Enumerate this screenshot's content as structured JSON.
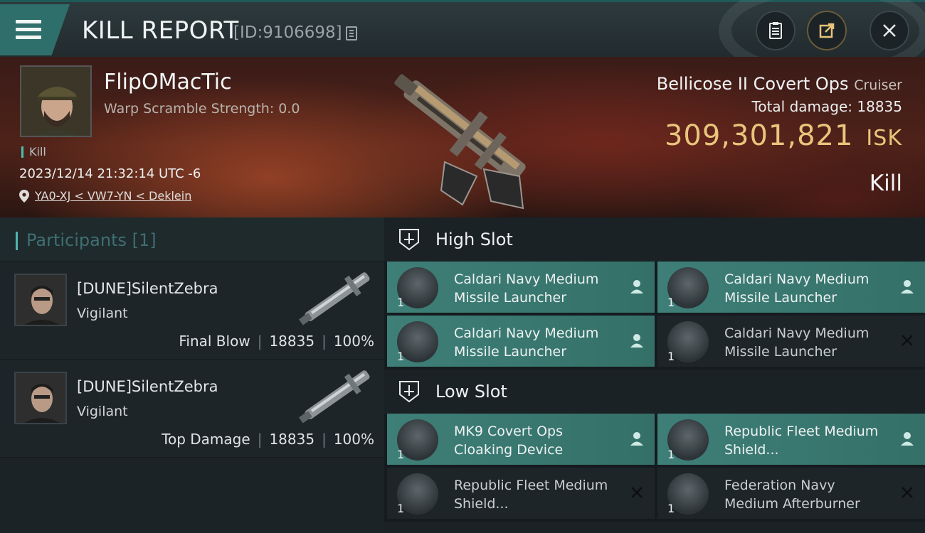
{
  "window": {
    "title": "KILL REPORT",
    "report_id": "[ID:9106698]"
  },
  "victim": {
    "name": "FlipOMacTic",
    "warp_scramble": "Warp Scramble Strength: 0.0",
    "tag": "Kill",
    "timestamp": "2023/12/14 21:32:14 UTC -6",
    "location": "YA0-XJ < VW7-YN < Deklein",
    "ship_name": "Bellicose II Covert Ops",
    "ship_class": "Cruiser",
    "total_damage_label": "Total damage:",
    "total_damage": "18835",
    "isk_value": "309,301,821",
    "isk_unit": "ISK",
    "result": "Kill"
  },
  "participants": {
    "header": "Participants [1]",
    "items": [
      {
        "name": "[DUNE]SilentZebra",
        "ship": "Vigilant",
        "role": "Final Blow",
        "damage": "18835",
        "percent": "100%"
      },
      {
        "name": "[DUNE]SilentZebra",
        "ship": "Vigilant",
        "role": "Top Damage",
        "damage": "18835",
        "percent": "100%"
      }
    ]
  },
  "fitting": {
    "high_slot_label": "High Slot",
    "low_slot_label": "Low Slot",
    "high_slot": [
      {
        "name": "Caldari Navy Medium Missile Launcher",
        "qty": "1",
        "status": "dropped"
      },
      {
        "name": "Caldari Navy Medium Missile Launcher",
        "qty": "1",
        "status": "dropped"
      },
      {
        "name": "Caldari Navy Medium Missile Launcher",
        "qty": "1",
        "status": "dropped"
      },
      {
        "name": "Caldari Navy Medium Missile Launcher",
        "qty": "1",
        "status": "destroyed"
      }
    ],
    "low_slot": [
      {
        "name": "MK9 Covert Ops Cloaking Device",
        "qty": "1",
        "status": "dropped"
      },
      {
        "name": "Republic Fleet Medium Shield...",
        "qty": "1",
        "status": "dropped"
      },
      {
        "name": "Republic Fleet Medium Shield...",
        "qty": "1",
        "status": "destroyed"
      },
      {
        "name": "Federation Navy Medium Afterburner",
        "qty": "1",
        "status": "destroyed"
      }
    ]
  },
  "colors": {
    "accent_teal": "#3e7f78",
    "isk_gold": "#e9c57c",
    "header_bg": "#2d3a3d"
  },
  "icons": {
    "menu": "hamburger-icon",
    "copy": "copy-icon",
    "clipboard": "clipboard-icon",
    "share": "share-icon",
    "close": "close-icon",
    "location": "location-pin-icon",
    "slot": "shield-slot-icon",
    "dropped": "person-icon",
    "destroyed": "x-icon"
  }
}
